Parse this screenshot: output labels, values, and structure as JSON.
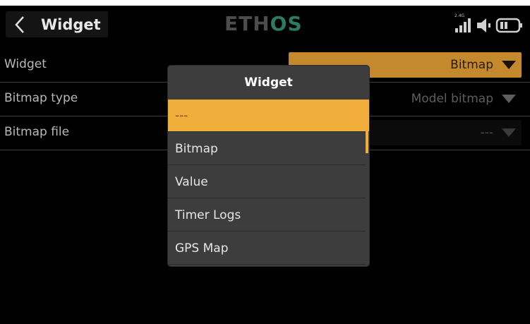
{
  "header": {
    "title": "Widget",
    "logo_a": "ETH",
    "logo_b": "OS",
    "signal_label": "2.4G"
  },
  "rows": [
    {
      "label": "Widget",
      "value": "Bitmap"
    },
    {
      "label": "Bitmap type",
      "value": "Model bitmap"
    },
    {
      "label": "Bitmap file",
      "value": "---"
    }
  ],
  "modal": {
    "title": "Widget",
    "options": [
      "---",
      "Bitmap",
      "Value",
      "Timer Logs",
      "GPS Map"
    ],
    "selected": "---"
  },
  "colors": {
    "accent": "#f1ad3a",
    "accent_dim": "#c3892c",
    "background": "#000000",
    "modal_bg": "#3d3d3d",
    "logo_os": "#2c7a60"
  },
  "icons": [
    "back-chevron-icon",
    "signal-strength-icon",
    "volume-icon",
    "battery-icon",
    "dropdown-arrow-icon"
  ]
}
